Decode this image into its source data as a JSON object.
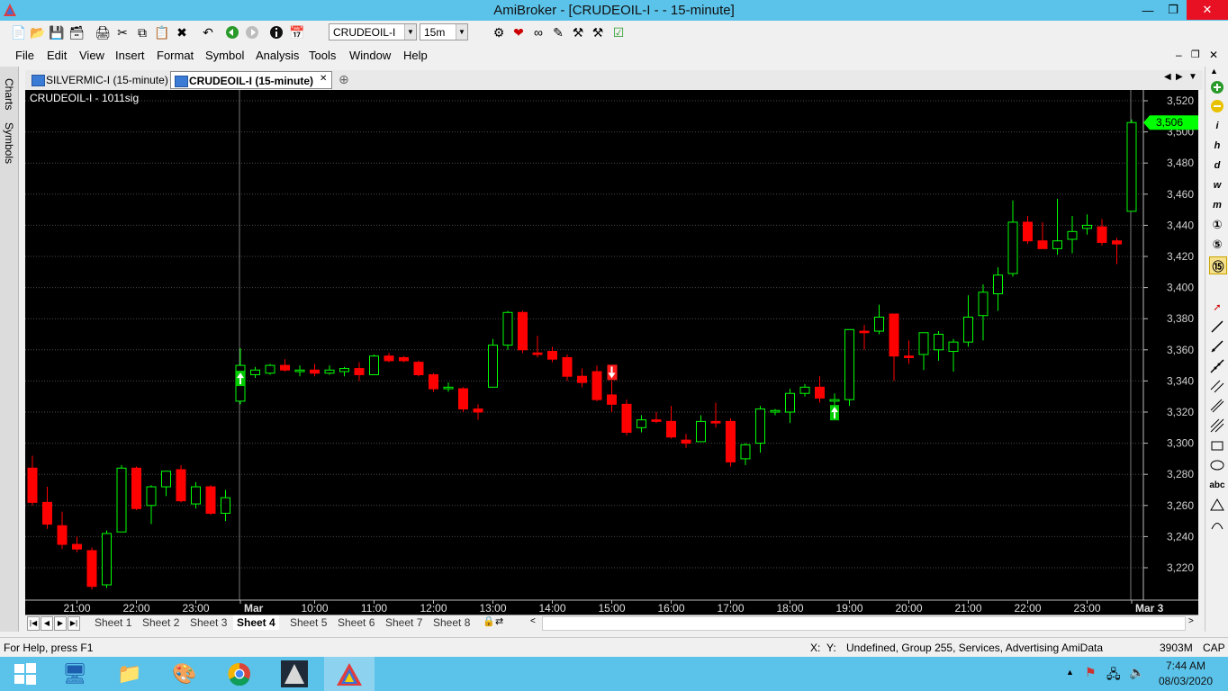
{
  "window": {
    "title": "AmiBroker - [CRUDEOIL-I -  - 15-minute]",
    "minimize_icon": "minimize-icon",
    "restore_icon": "restore-icon",
    "close_icon": "close-icon"
  },
  "toolbar": {
    "symbol_value": "CRUDEOIL-I",
    "interval_value": "15m"
  },
  "menu": [
    "File",
    "Edit",
    "View",
    "Insert",
    "Format",
    "Symbol",
    "Analysis",
    "Tools",
    "Window",
    "Help"
  ],
  "left_tabs": [
    "Charts",
    "Symbols"
  ],
  "doc_tabs": [
    {
      "label": "SILVERMIC-I (15-minute)",
      "active": false
    },
    {
      "label": "CRUDEOIL-I (15-minute)",
      "active": true
    }
  ],
  "chart_data": {
    "type": "candlestick",
    "title": "CRUDEOIL-I - 1011sig",
    "ylim": [
      3200,
      3530
    ],
    "yticks": [
      3220,
      3240,
      3260,
      3280,
      3300,
      3320,
      3340,
      3360,
      3380,
      3400,
      3420,
      3440,
      3460,
      3480,
      3500,
      3520
    ],
    "ytick_labels": [
      "3,220",
      "3,240",
      "3,260",
      "3,280",
      "3,300",
      "3,320",
      "3,340",
      "3,360",
      "3,380",
      "3,400",
      "3,420",
      "3,440",
      "3,460",
      "3,480",
      "3,500",
      "3,520"
    ],
    "xtick_labels": [
      {
        "label": "21:00",
        "index": 3
      },
      {
        "label": "22:00",
        "index": 7
      },
      {
        "label": "23:00",
        "index": 11
      },
      {
        "label": "Mar",
        "index": 14
      },
      {
        "label": "10:00",
        "index": 19
      },
      {
        "label": "11:00",
        "index": 23
      },
      {
        "label": "12:00",
        "index": 27
      },
      {
        "label": "13:00",
        "index": 31
      },
      {
        "label": "14:00",
        "index": 35
      },
      {
        "label": "15:00",
        "index": 39
      },
      {
        "label": "16:00",
        "index": 43
      },
      {
        "label": "17:00",
        "index": 47
      },
      {
        "label": "18:00",
        "index": 51
      },
      {
        "label": "19:00",
        "index": 55
      },
      {
        "label": "20:00",
        "index": 59
      },
      {
        "label": "21:00",
        "index": 63
      },
      {
        "label": "22:00",
        "index": 67
      },
      {
        "label": "23:00",
        "index": 71
      },
      {
        "label": "Mar 3",
        "index": 74
      }
    ],
    "candles": [
      [
        3284,
        3292,
        3260,
        3262
      ],
      [
        3262,
        3272,
        3245,
        3248
      ],
      [
        3247,
        3256,
        3232,
        3235
      ],
      [
        3235,
        3240,
        3230,
        3232
      ],
      [
        3231,
        3233,
        3206,
        3208
      ],
      [
        3209,
        3244,
        3207,
        3242
      ],
      [
        3243,
        3286,
        3243,
        3284
      ],
      [
        3284,
        3285,
        3257,
        3258
      ],
      [
        3260,
        3273,
        3248,
        3272
      ],
      [
        3272,
        3282,
        3266,
        3282
      ],
      [
        3283,
        3286,
        3262,
        3263
      ],
      [
        3261,
        3275,
        3258,
        3272
      ],
      [
        3272,
        3273,
        3254,
        3255
      ],
      [
        3255,
        3270,
        3250,
        3265
      ],
      [
        3327,
        3361,
        3325,
        3350
      ],
      [
        3344,
        3349,
        3342,
        3347
      ],
      [
        3345,
        3351,
        3344,
        3350
      ],
      [
        3350,
        3354,
        3346,
        3347
      ],
      [
        3346,
        3350,
        3343,
        3347
      ],
      [
        3347,
        3351,
        3343,
        3345
      ],
      [
        3345,
        3350,
        3344,
        3347
      ],
      [
        3346,
        3349,
        3343,
        3348
      ],
      [
        3348,
        3352,
        3340,
        3344
      ],
      [
        3344,
        3357,
        3344,
        3356
      ],
      [
        3356,
        3358,
        3352,
        3353
      ],
      [
        3355,
        3356,
        3352,
        3353
      ],
      [
        3352,
        3353,
        3343,
        3344
      ],
      [
        3344,
        3345,
        3333,
        3335
      ],
      [
        3335,
        3339,
        3333,
        3336
      ],
      [
        3335,
        3336,
        3320,
        3322
      ],
      [
        3322,
        3325,
        3315,
        3320
      ],
      [
        3336,
        3367,
        3336,
        3363
      ],
      [
        3363,
        3385,
        3360,
        3384
      ],
      [
        3384,
        3385,
        3358,
        3360
      ],
      [
        3358,
        3369,
        3355,
        3357
      ],
      [
        3359,
        3362,
        3352,
        3354
      ],
      [
        3355,
        3357,
        3340,
        3343
      ],
      [
        3343,
        3348,
        3336,
        3339
      ],
      [
        3346,
        3350,
        3327,
        3328
      ],
      [
        3331,
        3340,
        3320,
        3325
      ],
      [
        3325,
        3328,
        3305,
        3307
      ],
      [
        3310,
        3318,
        3307,
        3315
      ],
      [
        3315,
        3320,
        3313,
        3314
      ],
      [
        3314,
        3324,
        3303,
        3304
      ],
      [
        3302,
        3306,
        3297,
        3300
      ],
      [
        3301,
        3318,
        3301,
        3314
      ],
      [
        3314,
        3326,
        3310,
        3313
      ],
      [
        3314,
        3316,
        3285,
        3288
      ],
      [
        3290,
        3300,
        3286,
        3299
      ],
      [
        3300,
        3324,
        3294,
        3322
      ],
      [
        3320,
        3322,
        3318,
        3321
      ],
      [
        3320,
        3335,
        3313,
        3332
      ],
      [
        3332,
        3338,
        3330,
        3336
      ],
      [
        3336,
        3343,
        3326,
        3329
      ],
      [
        3327,
        3332,
        3318,
        3328
      ],
      [
        3328,
        3373,
        3324,
        3373
      ],
      [
        3372,
        3376,
        3360,
        3371
      ],
      [
        3372,
        3389,
        3370,
        3381
      ],
      [
        3383,
        3383,
        3340,
        3356
      ],
      [
        3356,
        3366,
        3351,
        3355
      ],
      [
        3357,
        3371,
        3347,
        3371
      ],
      [
        3360,
        3372,
        3353,
        3370
      ],
      [
        3359,
        3367,
        3346,
        3365
      ],
      [
        3365,
        3395,
        3362,
        3381
      ],
      [
        3382,
        3402,
        3366,
        3397
      ],
      [
        3396,
        3413,
        3385,
        3408
      ],
      [
        3409,
        3456,
        3407,
        3442
      ],
      [
        3442,
        3446,
        3428,
        3430
      ],
      [
        3430,
        3442,
        3426,
        3425
      ],
      [
        3425,
        3457,
        3421,
        3430
      ],
      [
        3431,
        3446,
        3422,
        3436
      ],
      [
        3438,
        3447,
        3434,
        3440
      ],
      [
        3439,
        3444,
        3427,
        3429
      ],
      [
        3430,
        3432,
        3415,
        3428
      ],
      [
        3449,
        3508,
        3449,
        3506
      ]
    ],
    "signals": [
      {
        "index": 14,
        "type": "buy"
      },
      {
        "index": 39,
        "type": "sell"
      },
      {
        "index": 54,
        "type": "buy"
      }
    ],
    "last_price_label": "3,506",
    "up_color": "#00ff00",
    "down_color": "#ff0000",
    "background": "#000000",
    "grid": true
  },
  "sheets": [
    "Sheet 1",
    "Sheet 2",
    "Sheet 3",
    "Sheet 4",
    "Sheet 5",
    "Sheet 6",
    "Sheet 7",
    "Sheet 8"
  ],
  "active_sheet": "Sheet 4",
  "status": {
    "help": "For Help, press F1",
    "x": "X:",
    "y": "Y:",
    "info": "Undefined, Group 255, Services, Advertising",
    "db": "AmiData",
    "mem": "3903M",
    "caps": "CAP"
  },
  "clock": {
    "time": "7:44 AM",
    "date": "08/03/2020"
  }
}
